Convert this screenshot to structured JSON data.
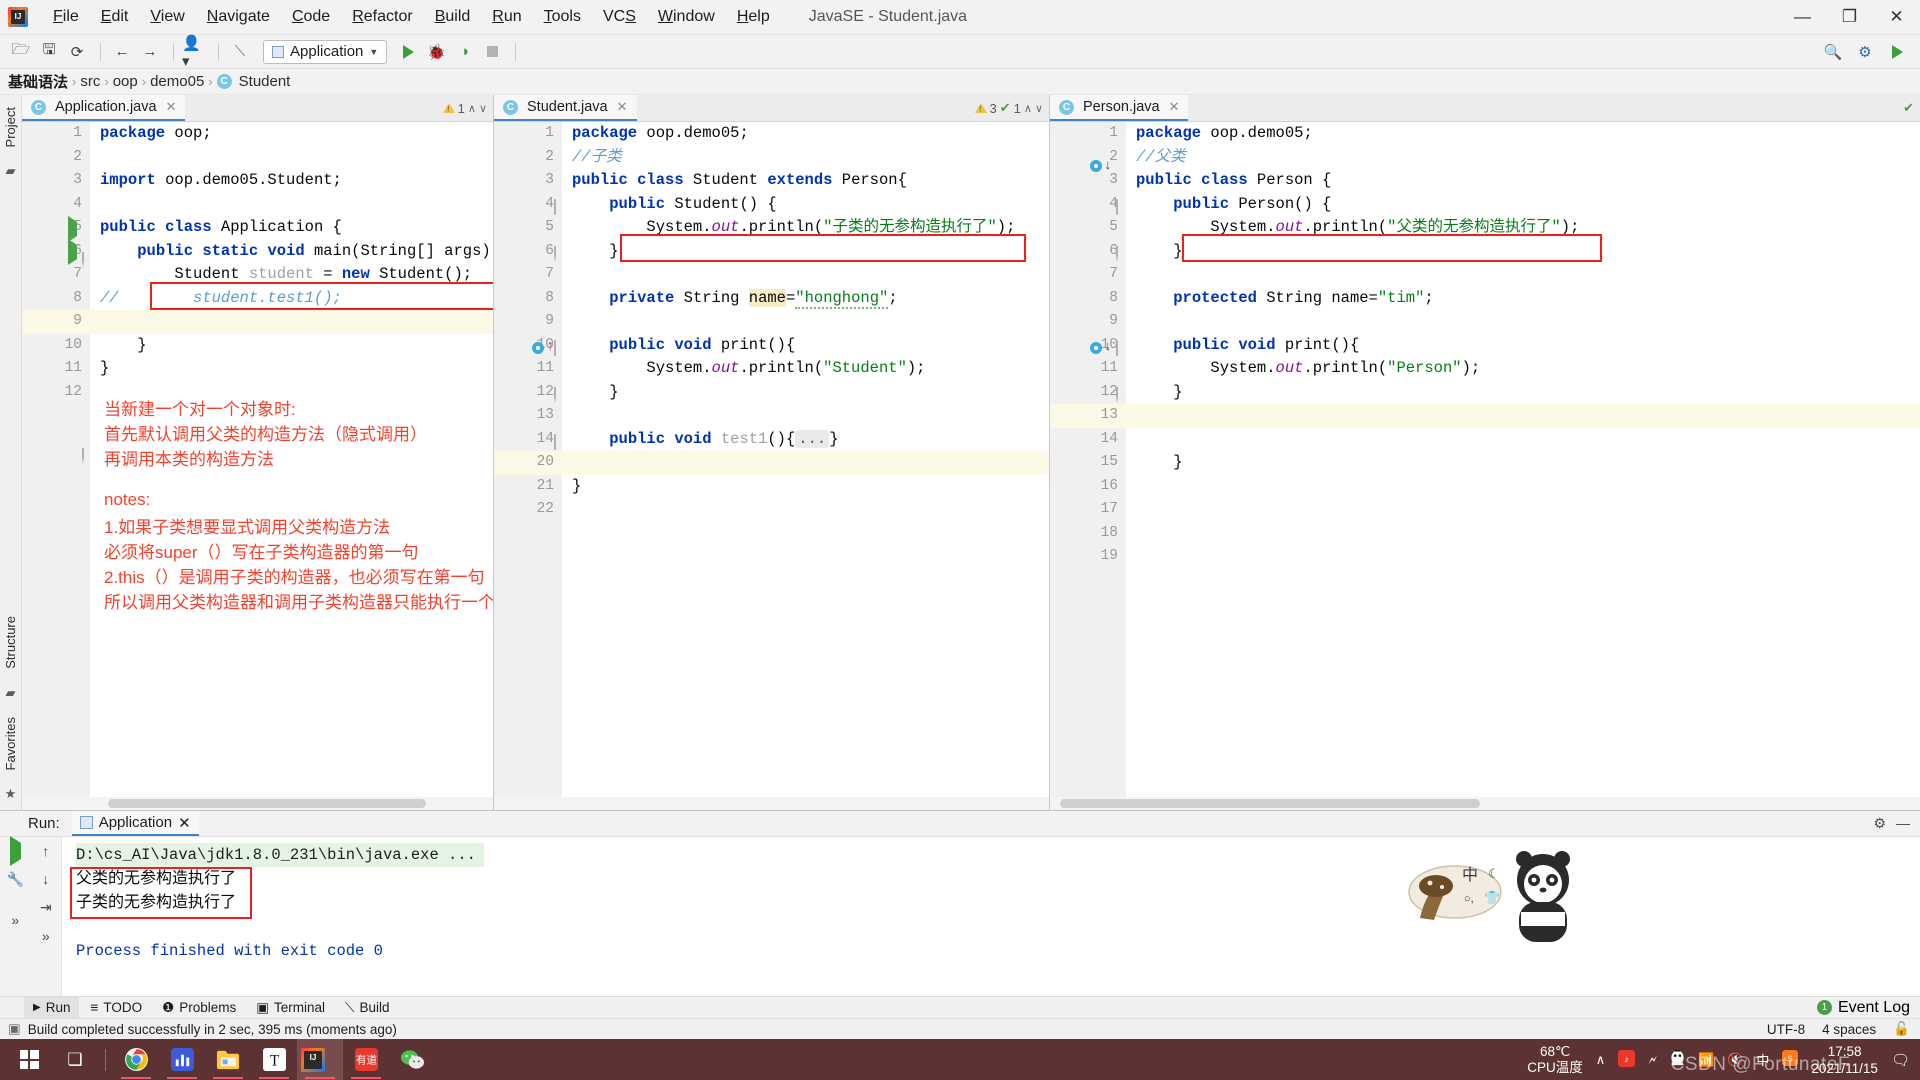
{
  "window": {
    "title": "JavaSE - Student.java",
    "minimize": "—",
    "maximize": "❐",
    "close": "✕"
  },
  "menu": {
    "items": [
      "File",
      "Edit",
      "View",
      "Navigate",
      "Code",
      "Refactor",
      "Build",
      "Run",
      "Tools",
      "VCS",
      "Window",
      "Help"
    ]
  },
  "toolbar": {
    "icons": [
      "open-folder-icon",
      "save-icon",
      "sync-icon",
      "back-arrow-icon",
      "forward-arrow-icon",
      "profile-icon",
      "build-hammer-icon"
    ],
    "run_config_label": "Application",
    "run_config_caret": "▼",
    "right_icons": [
      "search-icon",
      "settings-gear-icon",
      "run-anything-icon"
    ]
  },
  "breadcrumb": {
    "items": [
      "基础语法",
      "src",
      "oop",
      "demo05",
      "Student"
    ],
    "separator": "›",
    "class_badge": "C"
  },
  "rails": {
    "left_top": "Project",
    "left_bottom_1": "Structure",
    "left_bottom_2": "Favorites",
    "right": ""
  },
  "editors": [
    {
      "tab": "Application.java",
      "tab_icon": "java-class-icon",
      "close": "✕",
      "warn_count": "1",
      "check_count": "",
      "up": "∧",
      "down": "∨",
      "lines": [
        {
          "n": "1",
          "text": "package oop;"
        },
        {
          "n": "2",
          "text": ""
        },
        {
          "n": "3",
          "text": "import oop.demo05.Student;"
        },
        {
          "n": "4",
          "text": ""
        },
        {
          "n": "5",
          "text": "public class Application {"
        },
        {
          "n": "6",
          "text": "    public static void main(String[] args)"
        },
        {
          "n": "7",
          "text": "        Student student = new Student();"
        },
        {
          "n": "8",
          "text": "//        student.test1();"
        },
        {
          "n": "9",
          "text": ""
        },
        {
          "n": "10",
          "text": "    }"
        },
        {
          "n": "11",
          "text": "}"
        },
        {
          "n": "12",
          "text": ""
        }
      ],
      "annotation": {
        "line1": "当新建一个对一个对象时:",
        "line2": "首先默认调用父类的构造方法（隐式调用）",
        "line3": "再调用本类的构造方法",
        "line4": "",
        "line5": "notes:",
        "line6": "1.如果子类想要显式调用父类构造方法",
        "line7": "必须将super（）写在子类构造器的第一句",
        "line8": "2.this（）是调用子类的构造器，也必须写在第一句",
        "line9": "所以调用父类构造器和调用子类构造器只能执行一个"
      }
    },
    {
      "tab": "Student.java",
      "tab_icon": "java-class-icon",
      "close": "✕",
      "warn_count": "3",
      "check_count": "1",
      "up": "∧",
      "down": "∨",
      "lines": [
        {
          "n": "1",
          "text": "package oop.demo05;"
        },
        {
          "n": "2",
          "text": "//子类"
        },
        {
          "n": "3",
          "text": "public class Student extends Person{"
        },
        {
          "n": "4",
          "text": "    public Student() {"
        },
        {
          "n": "5",
          "text": "        System.out.println(\"子类的无参构造执行了\");"
        },
        {
          "n": "6",
          "text": "    }"
        },
        {
          "n": "7",
          "text": ""
        },
        {
          "n": "8",
          "text": "    private String name=\"honghong\";"
        },
        {
          "n": "9",
          "text": ""
        },
        {
          "n": "10",
          "text": "    public void print(){"
        },
        {
          "n": "11",
          "text": "        System.out.println(\"Student\");"
        },
        {
          "n": "12",
          "text": "    }"
        },
        {
          "n": "13",
          "text": ""
        },
        {
          "n": "14",
          "text": "    public void test1(){...}"
        },
        {
          "n": "20",
          "text": ""
        },
        {
          "n": "21",
          "text": "}"
        },
        {
          "n": "22",
          "text": ""
        }
      ]
    },
    {
      "tab": "Person.java",
      "tab_icon": "java-class-icon",
      "close": "✕",
      "warn_count": "",
      "check_count": "",
      "lines": [
        {
          "n": "1",
          "text": "package oop.demo05;"
        },
        {
          "n": "2",
          "text": "//父类"
        },
        {
          "n": "3",
          "text": "public class Person {"
        },
        {
          "n": "4",
          "text": "    public Person() {"
        },
        {
          "n": "5",
          "text": "        System.out.println(\"父类的无参构造执行了\");"
        },
        {
          "n": "6",
          "text": "    }"
        },
        {
          "n": "7",
          "text": ""
        },
        {
          "n": "8",
          "text": "    protected String name=\"tim\";"
        },
        {
          "n": "9",
          "text": ""
        },
        {
          "n": "10",
          "text": "    public void print(){"
        },
        {
          "n": "11",
          "text": "        System.out.println(\"Person\");"
        },
        {
          "n": "12",
          "text": "    }"
        },
        {
          "n": "13",
          "text": ""
        },
        {
          "n": "14",
          "text": ""
        },
        {
          "n": "15",
          "text": "    }"
        },
        {
          "n": "16",
          "text": ""
        },
        {
          "n": "17",
          "text": ""
        },
        {
          "n": "18",
          "text": ""
        },
        {
          "n": "19",
          "text": ""
        }
      ]
    }
  ],
  "run_panel": {
    "label": "Run:",
    "tab": "Application",
    "tab_close": "✕",
    "settings_icon": "gear-icon",
    "minimize_icon": "minimize-icon",
    "console": {
      "command": "D:\\cs_AI\\Java\\jdk1.8.0_231\\bin\\java.exe ...",
      "out1": "父类的无参构造执行了",
      "out2": "子类的无参构造执行了",
      "finished": "Process finished with exit code 0"
    },
    "tools": [
      "run-icon",
      "rerun-up-icon",
      "wrench-icon",
      "scroll-down-icon",
      "stop-icon",
      "soft-wrap-icon",
      "expand-icon",
      "expand-icon-2"
    ]
  },
  "bottom_tabs": {
    "items": [
      {
        "label": "Run",
        "icon": "play-icon",
        "active": true
      },
      {
        "label": "TODO",
        "icon": "todo-list-icon",
        "active": false
      },
      {
        "label": "Problems",
        "icon": "problems-icon",
        "active": false
      },
      {
        "label": "Terminal",
        "icon": "terminal-icon",
        "active": false
      },
      {
        "label": "Build",
        "icon": "build-hammer-icon",
        "active": false
      }
    ],
    "event_log": "Event Log",
    "event_badge": "1"
  },
  "statusbar": {
    "message": "Build completed successfully in 2 sec, 395 ms (moments ago)",
    "encoding": "UTF-8",
    "indent": "4 spaces",
    "lock_icon": "unlock-icon"
  },
  "taskbar": {
    "apps": [
      "windows-start-icon",
      "task-view-icon",
      "chrome-icon",
      "stats-icon",
      "file-explorer-icon",
      "typora-icon",
      "intellij-idea-icon",
      "youdao-icon",
      "wechat-icon"
    ],
    "cpu_temp": "68℃",
    "cpu_label": "CPU温度",
    "tray_icons": [
      "chevron-up-icon",
      "qq-music-icon",
      "battery-icon",
      "qq-icon",
      "wifi-icon",
      "volume-muted-icon",
      "ime-chinese-icon",
      "sogou-icon"
    ],
    "time": "17:58",
    "date": "2021/11/15",
    "watermark": "CSDN @FortunateF"
  },
  "colors": {
    "accent_blue": "#4083c9",
    "annotation_red": "#f5422e",
    "redbox": "#ef1f1f",
    "string_green": "#067d17",
    "keyword_blue": "#0033b3",
    "taskbar_bg": "#5d3232"
  }
}
